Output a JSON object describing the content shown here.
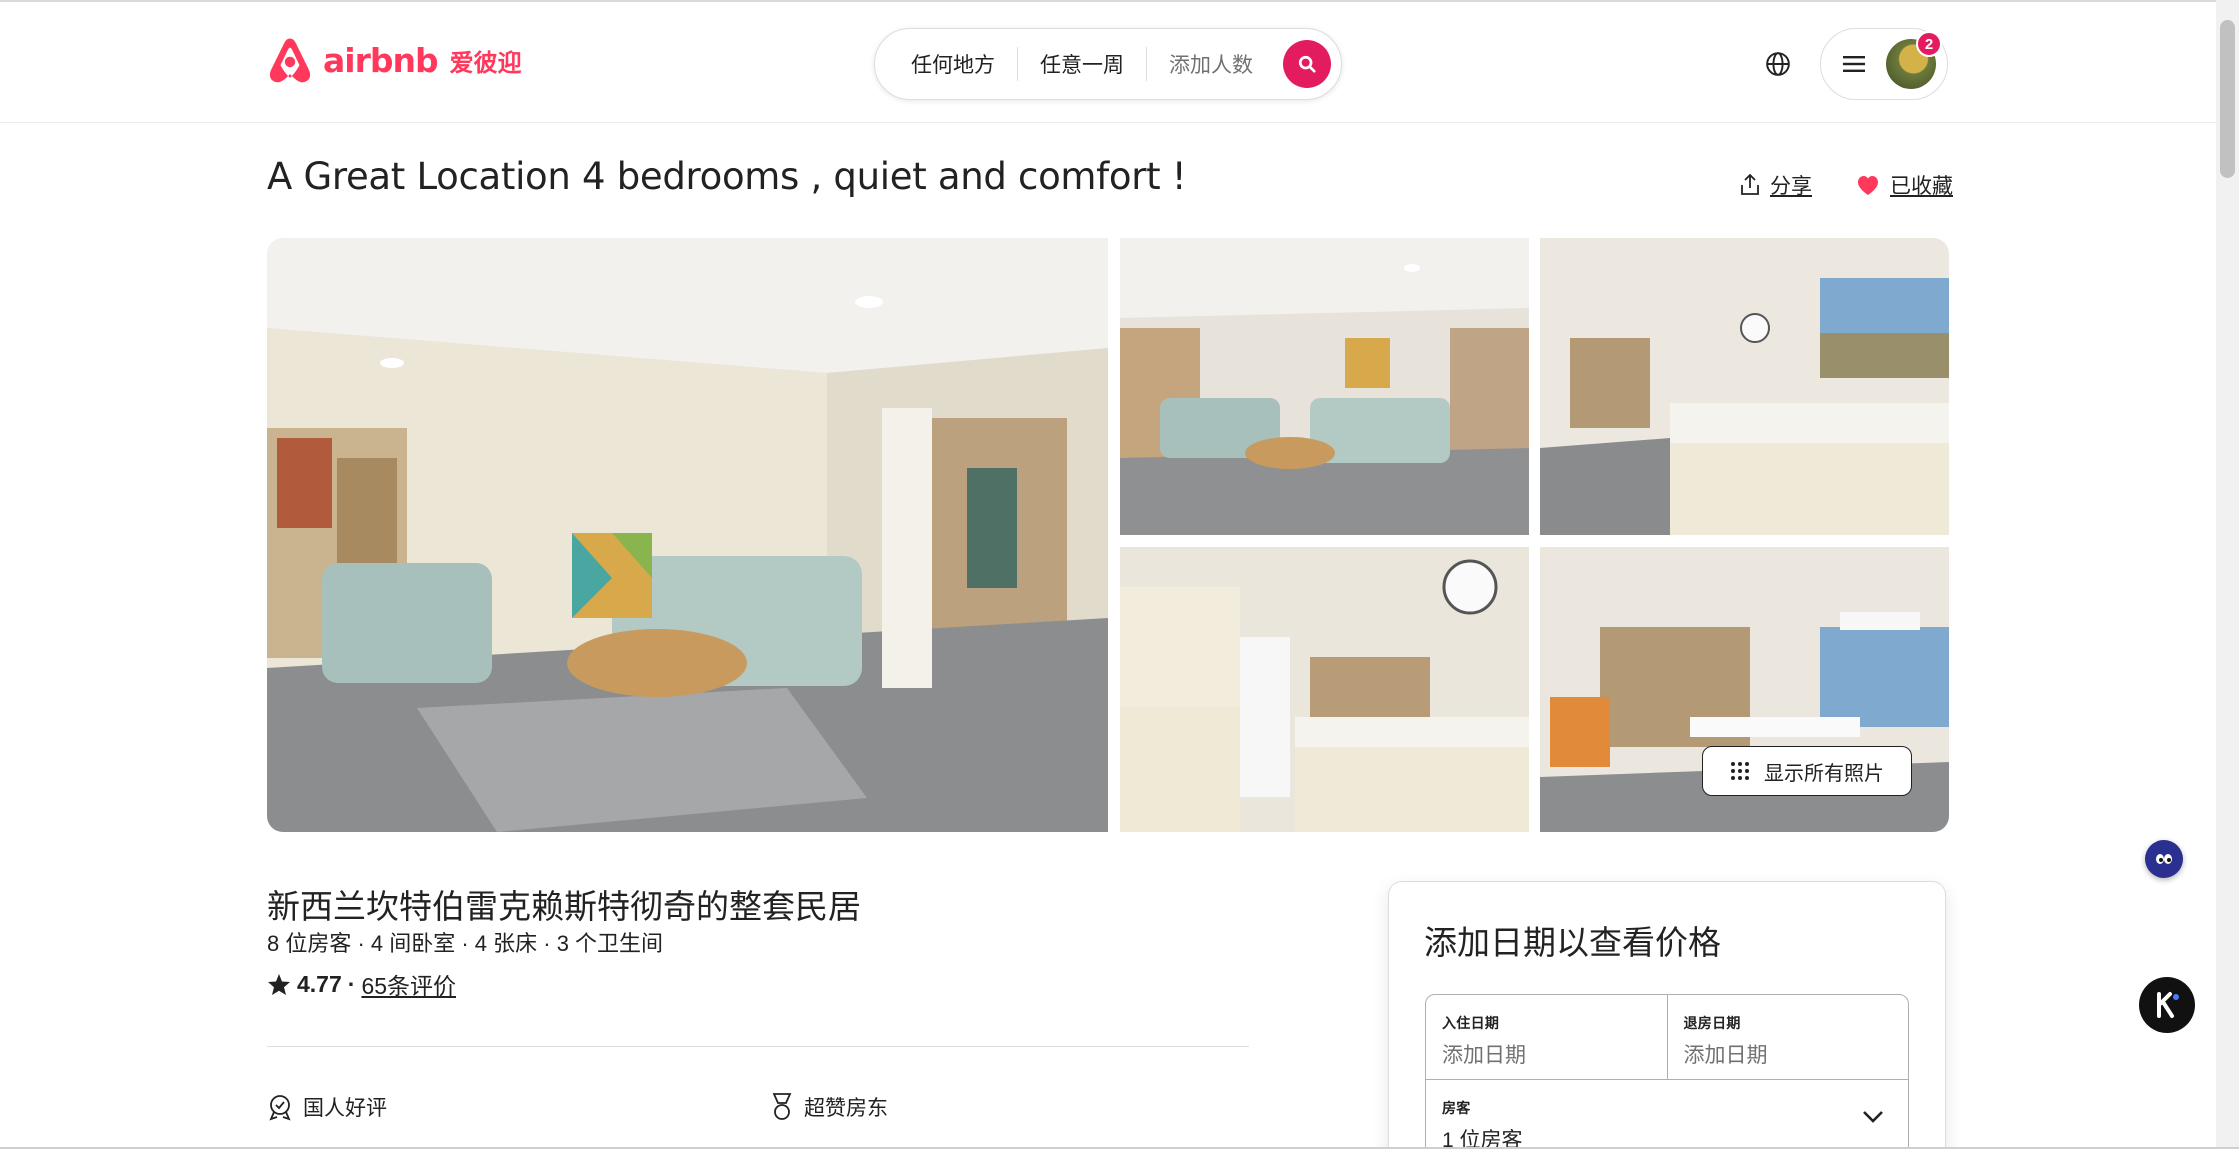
{
  "brand": {
    "name": "airbnb",
    "cn": "爱彼迎",
    "color": "#ff385c"
  },
  "search": {
    "where": "任何地方",
    "when": "任意一周",
    "guests": "添加人数",
    "button_icon": "search-icon"
  },
  "header": {
    "notifications": "2"
  },
  "listing": {
    "title": "A Great Location 4 bedrooms , quiet and comfort !",
    "share": "分享",
    "saved": "已收藏",
    "show_all_photos": "显示所有照片",
    "subtitle": "新西兰坎特伯雷克赖斯特彻奇的整套民居",
    "details": "8 位房客 · 4 间卧室 · 4 张床 · 3 个卫生间",
    "rating": "4.77",
    "rating_sep": "·",
    "reviews": "65条评价",
    "highlights": [
      "国人好评",
      "超赞房东"
    ]
  },
  "booking": {
    "title": "添加日期以查看价格",
    "checkin_label": "入住日期",
    "checkin_value": "添加日期",
    "checkout_label": "退房日期",
    "checkout_value": "添加日期",
    "guests_label": "房客",
    "guests_value": "1 位房客"
  },
  "accent": "#e31c5f"
}
